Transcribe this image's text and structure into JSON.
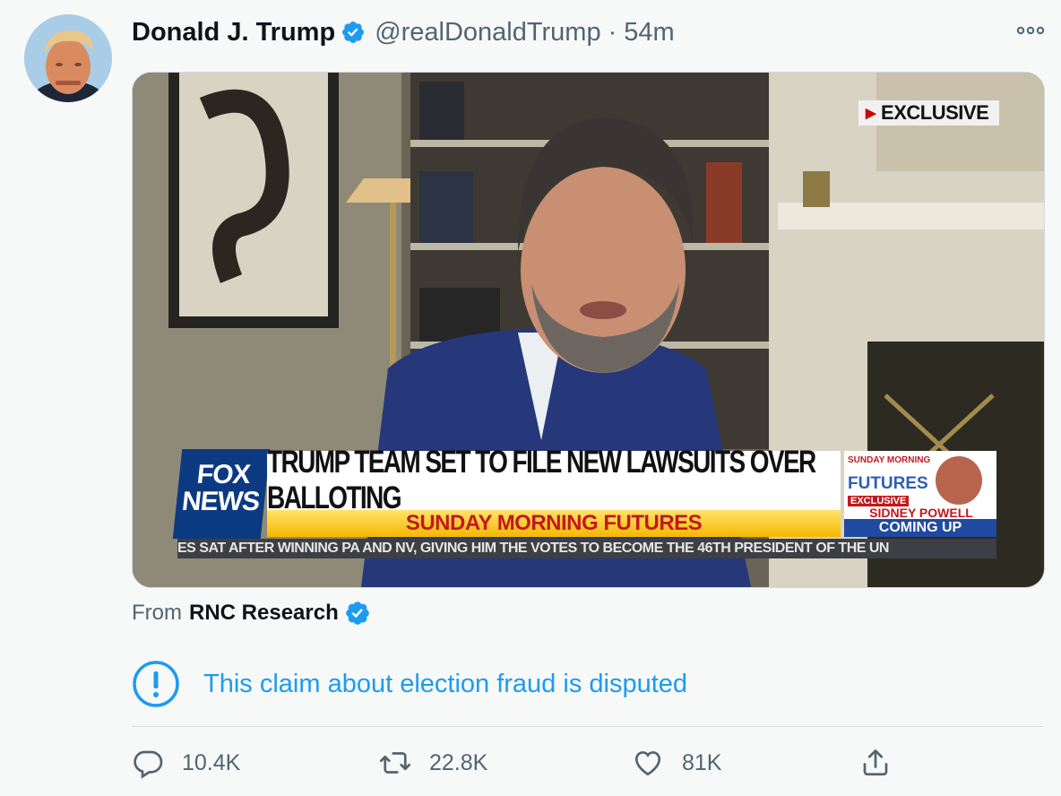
{
  "tweet": {
    "author_name": "Donald J. Trump",
    "handle": "@realDonaldTrump",
    "separator": "·",
    "time": "54m"
  },
  "media": {
    "exclusive_label": "EXCLUSIVE",
    "logo_line1": "FOX",
    "logo_line2": "NEWS",
    "headline": "TRUMP TEAM SET TO FILE NEW LAWSUITS OVER BALLOTING",
    "show_title": "SUNDAY MORNING FUTURES",
    "promo": {
      "line1": "SUNDAY MORNING",
      "line2": "FUTURES",
      "tag": "EXCLUSIVE",
      "guest": "SIDNEY POWELL",
      "coming": "COMING UP"
    },
    "ticker": "ES SAT AFTER WINNING PA AND NV, GIVING HIM THE VOTES TO BECOME THE 46TH PRESIDENT OF THE UN"
  },
  "source": {
    "prefix": "From",
    "name": "RNC Research"
  },
  "notice": {
    "text": "This claim about election fraud is disputed"
  },
  "actions": {
    "replies": "10.4K",
    "retweets": "22.8K",
    "likes": "81K"
  },
  "colors": {
    "accent": "#1d9bf0",
    "secondary_text": "#536471",
    "background": "#f7f9f9"
  },
  "icons": [
    "verified-badge-icon",
    "more-icon",
    "warning-icon",
    "reply-icon",
    "retweet-icon",
    "like-icon",
    "share-icon"
  ]
}
